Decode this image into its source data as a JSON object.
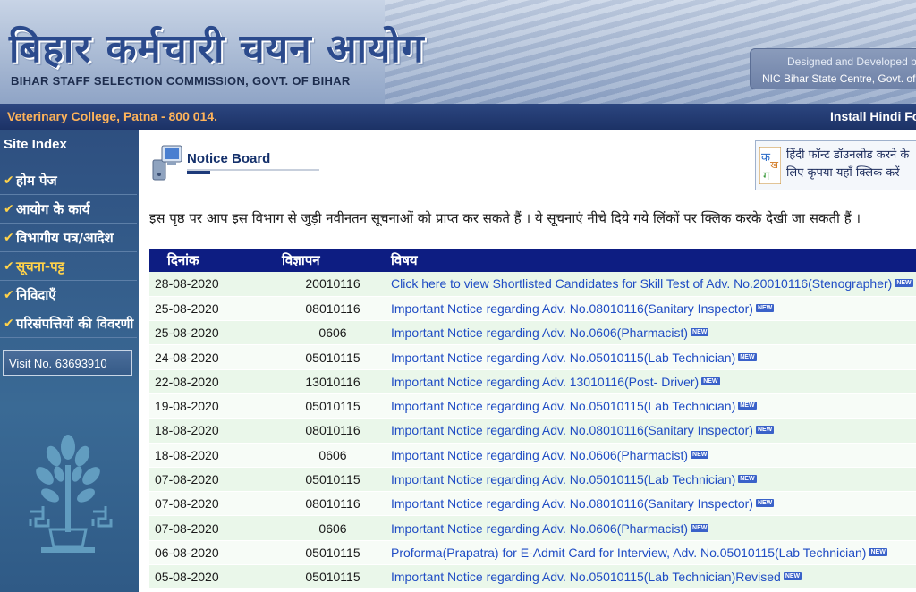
{
  "header": {
    "title_hindi": "बिहार कर्मचारी चयन आयोग",
    "title_english": "BIHAR STAFF SELECTION COMMISSION, GOVT. OF BIHAR",
    "credit_line1": "Designed and Developed by",
    "credit_line2": "NIC Bihar State Centre, Govt. of India"
  },
  "addressbar": {
    "address": "Veterinary College, Patna - 800 014.",
    "install_link": "Install Hindi Font"
  },
  "sidebar": {
    "heading": "Site Index",
    "items": [
      {
        "label": "होम पेज"
      },
      {
        "label": "आयोग के कार्य"
      },
      {
        "label": "विभागीय पत्र/आदेश"
      },
      {
        "label": "सूचना-पट्ट"
      },
      {
        "label": "निविदाएँ"
      },
      {
        "label": "परिसंपत्तियों की विवरणी"
      }
    ],
    "active_index": 3,
    "visit_counter": "Visit No.  63693910"
  },
  "main": {
    "section_title": "Notice Board",
    "font_box": {
      "logo_text": "क ख ग",
      "line1": "हिंदी फॉन्ट डॉउनलोड करने के",
      "line2": "लिए कृपया यहाँ क्लिक करें"
    },
    "intro": "इस पृष्ठ पर आप इस विभाग से जुड़ी नवीनतन सूचनाओं को प्राप्त कर सकते हैं । ये सूचनाएं नीचे दिये गये लिंकों पर क्लिक करके देखी जा सकती हैं ।",
    "table": {
      "headers": [
        "दिनांक",
        "विज्ञापन",
        "विषय"
      ],
      "new_badge": "NEW",
      "rows": [
        {
          "date": "28-08-2020",
          "adv": "20010116",
          "subject": "Click here to view Shortlisted Candidates for Skill Test of Adv. No.20010116(Stenographer)"
        },
        {
          "date": "25-08-2020",
          "adv": "08010116",
          "subject": "Important Notice regarding Adv. No.08010116(Sanitary Inspector)"
        },
        {
          "date": "25-08-2020",
          "adv": "0606",
          "subject": "Important Notice regarding Adv. No.0606(Pharmacist)"
        },
        {
          "date": "24-08-2020",
          "adv": "05010115",
          "subject": "Important Notice regarding Adv. No.05010115(Lab Technician)"
        },
        {
          "date": "22-08-2020",
          "adv": "13010116",
          "subject": "Important Notice regarding Adv. 13010116(Post- Driver)"
        },
        {
          "date": "19-08-2020",
          "adv": "05010115",
          "subject": "Important Notice regarding Adv. No.05010115(Lab Technician)"
        },
        {
          "date": "18-08-2020",
          "adv": "08010116",
          "subject": "Important Notice regarding Adv. No.08010116(Sanitary Inspector)"
        },
        {
          "date": "18-08-2020",
          "adv": "0606",
          "subject": "Important Notice regarding Adv. No.0606(Pharmacist)"
        },
        {
          "date": "07-08-2020",
          "adv": "05010115",
          "subject": "Important Notice regarding Adv. No.05010115(Lab Technician)"
        },
        {
          "date": "07-08-2020",
          "adv": "08010116",
          "subject": "Important Notice regarding Adv. No.08010116(Sanitary Inspector)"
        },
        {
          "date": "07-08-2020",
          "adv": "0606",
          "subject": "Important Notice regarding Adv. No.0606(Pharmacist)"
        },
        {
          "date": "06-08-2020",
          "adv": "05010115",
          "subject": "Proforma(Prapatra) for E-Admit Card for Interview, Adv. No.05010115(Lab Technician)"
        },
        {
          "date": "05-08-2020",
          "adv": "05010115",
          "subject": "Important Notice regarding Adv. No.05010115(Lab Technician)Revised"
        }
      ]
    }
  },
  "colors": {
    "header_bg": "#a9bad4",
    "addressbar_bg": "#1c3266",
    "address_text": "#ffb45a",
    "sidebar_bg": "#3a6a95",
    "table_header_bg": "#0d1d82",
    "row_bg": "#eaf7ea",
    "link": "#1f4cc4"
  }
}
